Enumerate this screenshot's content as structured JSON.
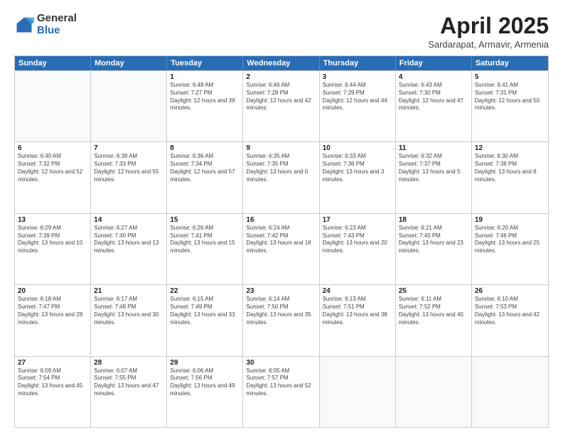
{
  "logo": {
    "general": "General",
    "blue": "Blue"
  },
  "title": {
    "month": "April 2025",
    "location": "Sardarapat, Armavir, Armenia"
  },
  "weekdays": [
    "Sunday",
    "Monday",
    "Tuesday",
    "Wednesday",
    "Thursday",
    "Friday",
    "Saturday"
  ],
  "rows": [
    [
      {
        "day": "",
        "sunrise": "",
        "sunset": "",
        "daylight": ""
      },
      {
        "day": "",
        "sunrise": "",
        "sunset": "",
        "daylight": ""
      },
      {
        "day": "1",
        "sunrise": "Sunrise: 6:48 AM",
        "sunset": "Sunset: 7:27 PM",
        "daylight": "Daylight: 12 hours and 39 minutes."
      },
      {
        "day": "2",
        "sunrise": "Sunrise: 6:46 AM",
        "sunset": "Sunset: 7:28 PM",
        "daylight": "Daylight: 12 hours and 42 minutes."
      },
      {
        "day": "3",
        "sunrise": "Sunrise: 6:44 AM",
        "sunset": "Sunset: 7:29 PM",
        "daylight": "Daylight: 12 hours and 44 minutes."
      },
      {
        "day": "4",
        "sunrise": "Sunrise: 6:43 AM",
        "sunset": "Sunset: 7:30 PM",
        "daylight": "Daylight: 12 hours and 47 minutes."
      },
      {
        "day": "5",
        "sunrise": "Sunrise: 6:41 AM",
        "sunset": "Sunset: 7:31 PM",
        "daylight": "Daylight: 12 hours and 50 minutes."
      }
    ],
    [
      {
        "day": "6",
        "sunrise": "Sunrise: 6:40 AM",
        "sunset": "Sunset: 7:32 PM",
        "daylight": "Daylight: 12 hours and 52 minutes."
      },
      {
        "day": "7",
        "sunrise": "Sunrise: 6:38 AM",
        "sunset": "Sunset: 7:33 PM",
        "daylight": "Daylight: 12 hours and 55 minutes."
      },
      {
        "day": "8",
        "sunrise": "Sunrise: 6:36 AM",
        "sunset": "Sunset: 7:34 PM",
        "daylight": "Daylight: 12 hours and 57 minutes."
      },
      {
        "day": "9",
        "sunrise": "Sunrise: 6:35 AM",
        "sunset": "Sunset: 7:35 PM",
        "daylight": "Daylight: 13 hours and 0 minutes."
      },
      {
        "day": "10",
        "sunrise": "Sunrise: 6:33 AM",
        "sunset": "Sunset: 7:36 PM",
        "daylight": "Daylight: 13 hours and 3 minutes."
      },
      {
        "day": "11",
        "sunrise": "Sunrise: 6:32 AM",
        "sunset": "Sunset: 7:37 PM",
        "daylight": "Daylight: 13 hours and 5 minutes."
      },
      {
        "day": "12",
        "sunrise": "Sunrise: 6:30 AM",
        "sunset": "Sunset: 7:38 PM",
        "daylight": "Daylight: 13 hours and 8 minutes."
      }
    ],
    [
      {
        "day": "13",
        "sunrise": "Sunrise: 6:29 AM",
        "sunset": "Sunset: 7:39 PM",
        "daylight": "Daylight: 13 hours and 10 minutes."
      },
      {
        "day": "14",
        "sunrise": "Sunrise: 6:27 AM",
        "sunset": "Sunset: 7:40 PM",
        "daylight": "Daylight: 13 hours and 13 minutes."
      },
      {
        "day": "15",
        "sunrise": "Sunrise: 6:26 AM",
        "sunset": "Sunset: 7:41 PM",
        "daylight": "Daylight: 13 hours and 15 minutes."
      },
      {
        "day": "16",
        "sunrise": "Sunrise: 6:24 AM",
        "sunset": "Sunset: 7:42 PM",
        "daylight": "Daylight: 13 hours and 18 minutes."
      },
      {
        "day": "17",
        "sunrise": "Sunrise: 6:23 AM",
        "sunset": "Sunset: 7:43 PM",
        "daylight": "Daylight: 13 hours and 20 minutes."
      },
      {
        "day": "18",
        "sunrise": "Sunrise: 6:21 AM",
        "sunset": "Sunset: 7:45 PM",
        "daylight": "Daylight: 13 hours and 23 minutes."
      },
      {
        "day": "19",
        "sunrise": "Sunrise: 6:20 AM",
        "sunset": "Sunset: 7:46 PM",
        "daylight": "Daylight: 13 hours and 25 minutes."
      }
    ],
    [
      {
        "day": "20",
        "sunrise": "Sunrise: 6:18 AM",
        "sunset": "Sunset: 7:47 PM",
        "daylight": "Daylight: 13 hours and 28 minutes."
      },
      {
        "day": "21",
        "sunrise": "Sunrise: 6:17 AM",
        "sunset": "Sunset: 7:48 PM",
        "daylight": "Daylight: 13 hours and 30 minutes."
      },
      {
        "day": "22",
        "sunrise": "Sunrise: 6:15 AM",
        "sunset": "Sunset: 7:49 PM",
        "daylight": "Daylight: 13 hours and 33 minutes."
      },
      {
        "day": "23",
        "sunrise": "Sunrise: 6:14 AM",
        "sunset": "Sunset: 7:50 PM",
        "daylight": "Daylight: 13 hours and 35 minutes."
      },
      {
        "day": "24",
        "sunrise": "Sunrise: 6:13 AM",
        "sunset": "Sunset: 7:51 PM",
        "daylight": "Daylight: 13 hours and 38 minutes."
      },
      {
        "day": "25",
        "sunrise": "Sunrise: 6:11 AM",
        "sunset": "Sunset: 7:52 PM",
        "daylight": "Daylight: 13 hours and 40 minutes."
      },
      {
        "day": "26",
        "sunrise": "Sunrise: 6:10 AM",
        "sunset": "Sunset: 7:53 PM",
        "daylight": "Daylight: 13 hours and 42 minutes."
      }
    ],
    [
      {
        "day": "27",
        "sunrise": "Sunrise: 6:09 AM",
        "sunset": "Sunset: 7:54 PM",
        "daylight": "Daylight: 13 hours and 45 minutes."
      },
      {
        "day": "28",
        "sunrise": "Sunrise: 6:07 AM",
        "sunset": "Sunset: 7:55 PM",
        "daylight": "Daylight: 13 hours and 47 minutes."
      },
      {
        "day": "29",
        "sunrise": "Sunrise: 6:06 AM",
        "sunset": "Sunset: 7:56 PM",
        "daylight": "Daylight: 13 hours and 49 minutes."
      },
      {
        "day": "30",
        "sunrise": "Sunrise: 6:05 AM",
        "sunset": "Sunset: 7:57 PM",
        "daylight": "Daylight: 13 hours and 52 minutes."
      },
      {
        "day": "",
        "sunrise": "",
        "sunset": "",
        "daylight": ""
      },
      {
        "day": "",
        "sunrise": "",
        "sunset": "",
        "daylight": ""
      },
      {
        "day": "",
        "sunrise": "",
        "sunset": "",
        "daylight": ""
      }
    ]
  ]
}
